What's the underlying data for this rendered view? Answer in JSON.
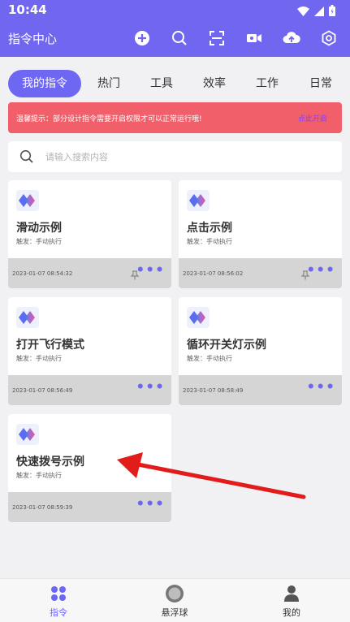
{
  "status_bar": {
    "time": "10:44"
  },
  "header": {
    "title": "指令中心",
    "actions": [
      "add-icon",
      "search-icon",
      "scan-icon",
      "video-icon",
      "upload-cloud-icon",
      "settings-hex-icon"
    ]
  },
  "tabs": [
    {
      "label": "我的指令",
      "active": true
    },
    {
      "label": "热门"
    },
    {
      "label": "工具"
    },
    {
      "label": "效率"
    },
    {
      "label": "工作"
    },
    {
      "label": "日常"
    }
  ],
  "notice": {
    "text": "温馨提示：部分设计指令需要开启权限才可以正常运行哦!",
    "link": "点此开启"
  },
  "search": {
    "placeholder": "请输入搜索内容",
    "value": ""
  },
  "cards": [
    {
      "title": "滑动示例",
      "trigger": "触发：手动执行",
      "date": "2023-01-07 08:54:32",
      "pinned": true
    },
    {
      "title": "点击示例",
      "trigger": "触发：手动执行",
      "date": "2023-01-07 08:56:02",
      "pinned": true
    },
    {
      "title": "打开飞行模式",
      "trigger": "触发：手动执行",
      "date": "2023-01-07 08:56:49",
      "pinned": false
    },
    {
      "title": "循环开关灯示例",
      "trigger": "触发：手动执行",
      "date": "2023-01-07 08:58:49",
      "pinned": false
    },
    {
      "title": "快速拨号示例",
      "trigger": "触发：手动执行",
      "date": "2023-01-07 08:59:39",
      "pinned": false
    }
  ],
  "more_label": "•••",
  "bottom_nav": [
    {
      "label": "指令",
      "icon": "grid-icon",
      "active": true
    },
    {
      "label": "悬浮球",
      "icon": "float-ball-icon"
    },
    {
      "label": "我的",
      "icon": "person-icon"
    }
  ],
  "colors": {
    "primary": "#7066f0",
    "notice": "#f1606a",
    "footer": "#d5d5d5"
  }
}
